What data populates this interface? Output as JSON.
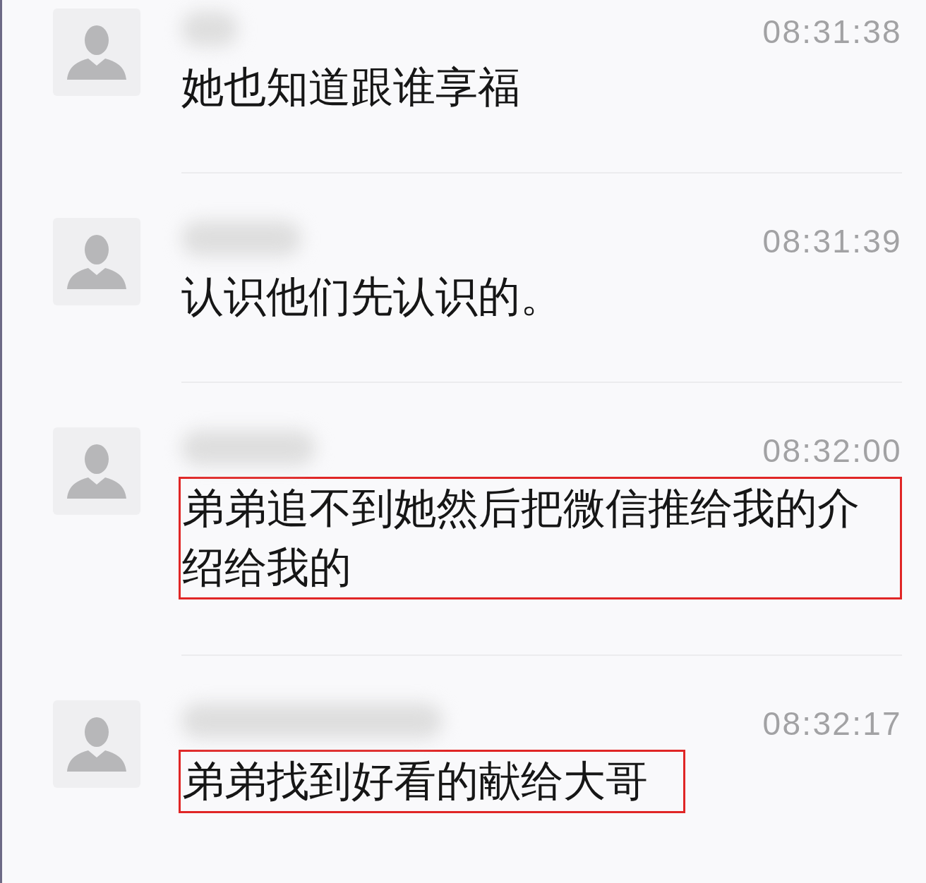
{
  "messages": [
    {
      "time": "08:31:38",
      "text": "她也知道跟谁享福",
      "highlighted": false
    },
    {
      "time": "08:31:39",
      "text": "认识他们先认识的。",
      "highlighted": false
    },
    {
      "time": "08:32:00",
      "text": "弟弟追不到她然后把微信推给我的介绍给我的",
      "highlighted": true
    },
    {
      "time": "08:32:17",
      "text": "弟弟找到好看的献给大哥",
      "highlighted": true
    }
  ]
}
